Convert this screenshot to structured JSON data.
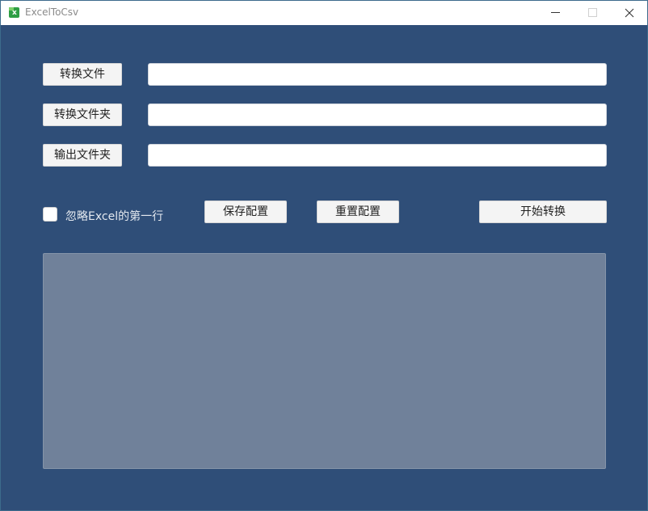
{
  "window": {
    "title": "ExcelToCsv"
  },
  "buttons": {
    "convert_file": "转换文件",
    "convert_folder": "转换文件夹",
    "output_folder": "输出文件夹",
    "save_config": "保存配置",
    "reset_config": "重置配置",
    "start_convert": "开始转换"
  },
  "fields": {
    "convert_file_value": "",
    "convert_folder_value": "",
    "output_folder_value": ""
  },
  "options": {
    "skip_first_row_label": "忽略Excel的第一行",
    "skip_first_row_checked": false
  },
  "log": {
    "content": ""
  },
  "colors": {
    "background": "#2f4e78",
    "log_background": "#70819a"
  }
}
